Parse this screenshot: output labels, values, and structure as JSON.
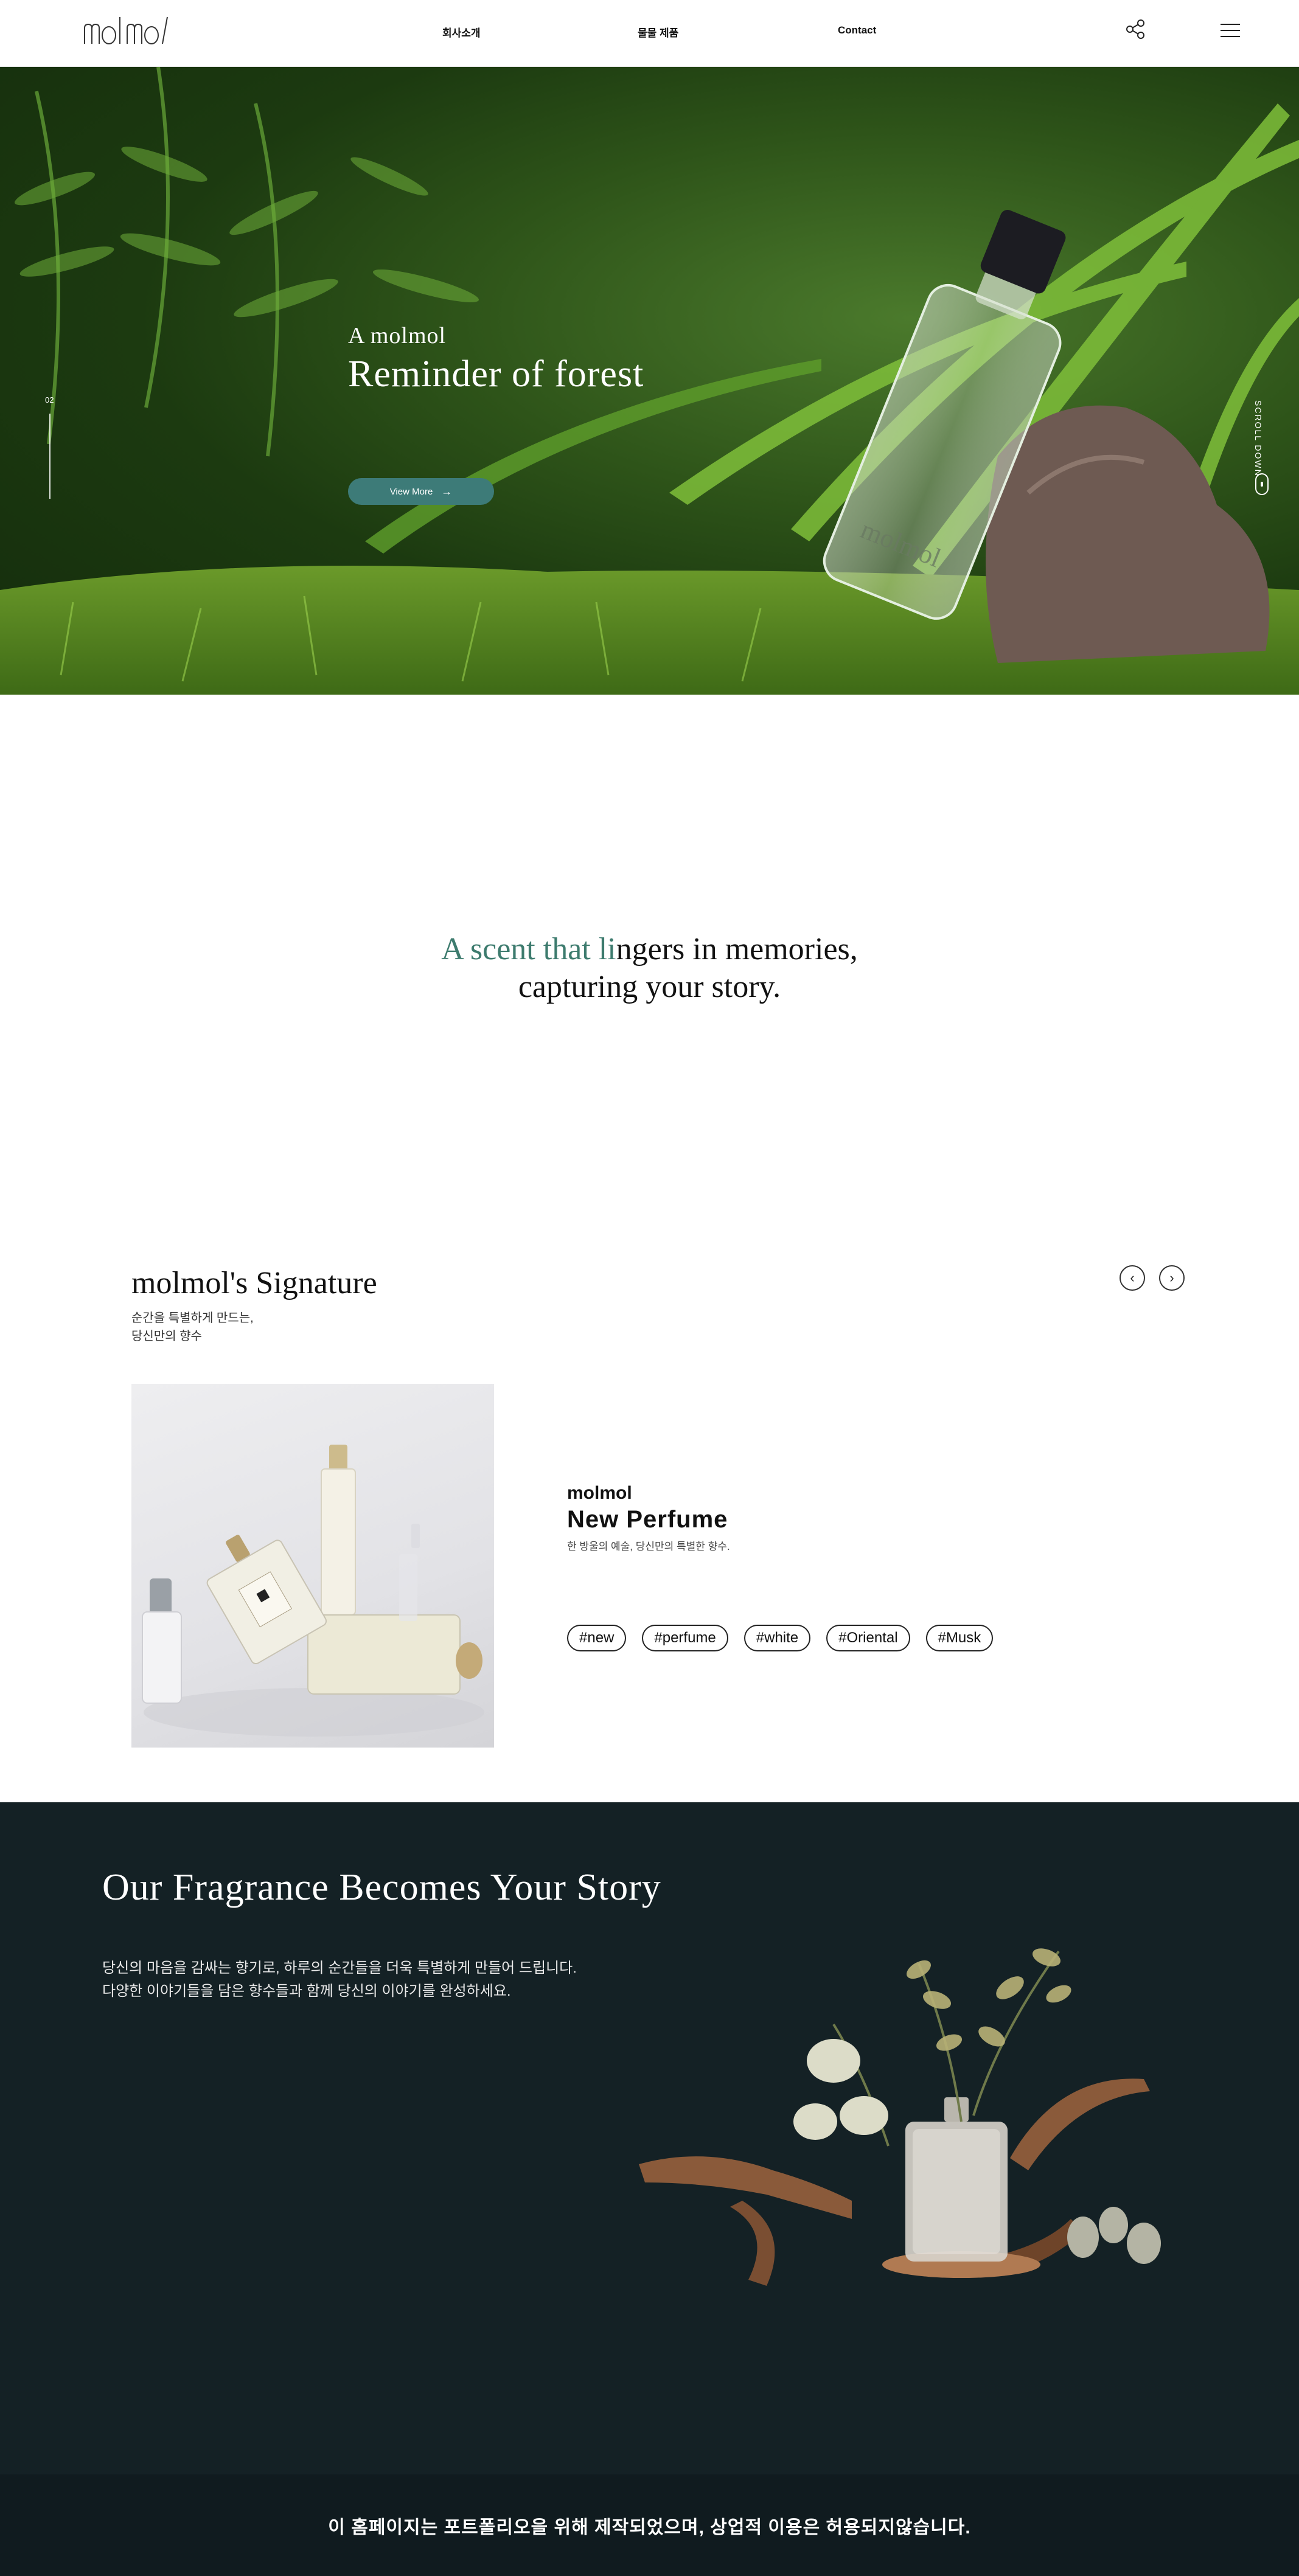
{
  "header": {
    "logo_text": "molmol",
    "nav": [
      "회사소개",
      "물물 제품",
      "Contact"
    ],
    "share_icon": "share-icon",
    "menu_icon": "hamburger-menu-icon"
  },
  "hero": {
    "subtitle": "A molmol",
    "title": "Reminder of forest",
    "button_label": "View More",
    "button_arrow": "→",
    "slide_number": "02",
    "scroll_label": "SCROLL DOWN",
    "bottle_label": "molmol"
  },
  "tagline": {
    "accent": "A scent that li",
    "rest": "ngers in memories,",
    "line2": "capturing your story."
  },
  "signature": {
    "title": "molmol's Signature",
    "desc_line1": "순간을 특별하게 만드는,",
    "desc_line2": "당신만의 향수",
    "prev_label": "‹",
    "next_label": "›",
    "product": {
      "brand": "molmol",
      "name": "New Perfume",
      "desc": "한 방울의 예술, 당신만의 특별한 향수."
    },
    "tags": [
      "#new",
      "#perfume",
      "#white",
      "#Oriental",
      "#Musk"
    ]
  },
  "story": {
    "title": "Our Fragrance Becomes Your Story",
    "text_line1": "당신의 마음을 감싸는 향기로, 하루의 순간들을 더욱 특별하게 만들어 드립니다.",
    "text_line2": "다양한 이야기들을 담은 향수들과 함께 당신의 이야기를 완성하세요."
  },
  "footer": {
    "notice": "이 홈페이지는 포트폴리오을 위해 제작되었으며, 상업적 이용은 허용되지않습니다."
  },
  "colors": {
    "accent_teal": "#3d7b78",
    "dark_bg": "#142125"
  }
}
